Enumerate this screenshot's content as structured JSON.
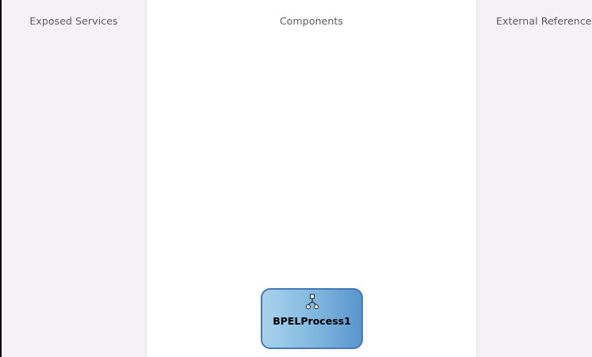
{
  "lanes": {
    "exposed_services": {
      "title": "Exposed Services"
    },
    "components": {
      "title": "Components"
    },
    "external_references": {
      "title": "External References"
    }
  },
  "component": {
    "label": "BPELProcess1",
    "icon": "bpel-process-icon"
  },
  "colors": {
    "lane_side_bg": "#f5f2f5",
    "lane_center_bg": "#ffffff",
    "component_border": "#4a78b4",
    "component_fill_light": "#a9d3ed",
    "component_fill_dark": "#5a96cd"
  }
}
